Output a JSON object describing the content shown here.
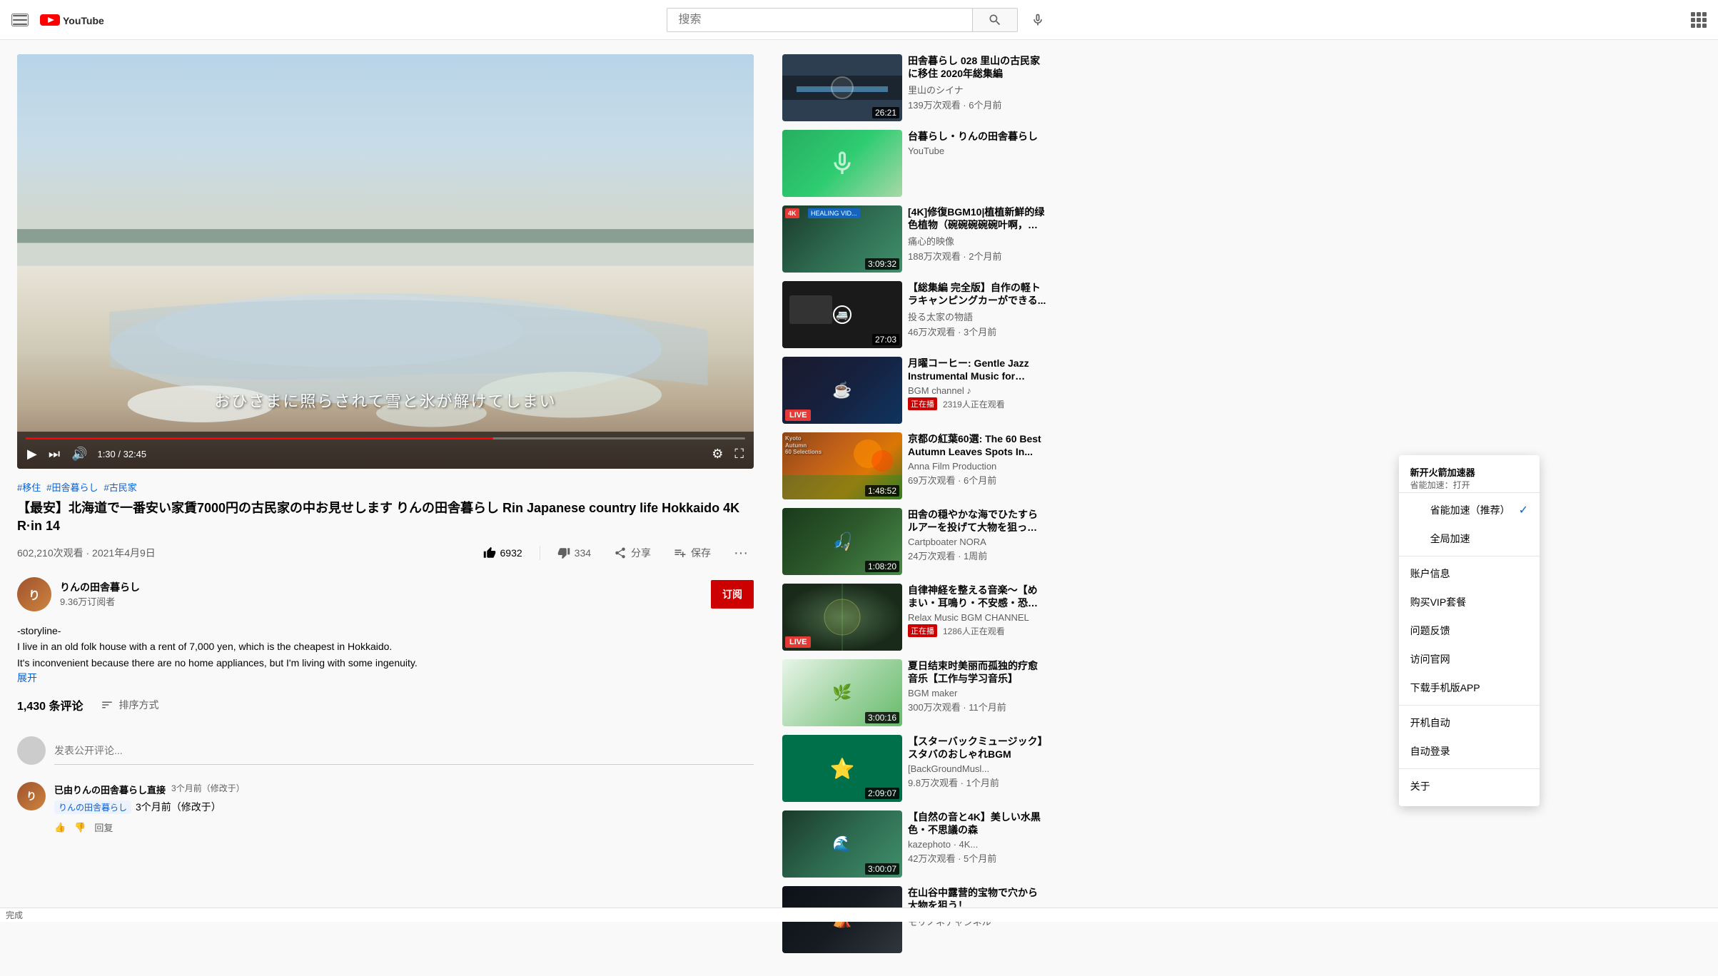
{
  "header": {
    "search_placeholder": "搜索",
    "search_value": ""
  },
  "video": {
    "tags": [
      "#移住",
      "#田舎暮らし",
      "#古民家"
    ],
    "title": "【最安】北海道で一番安い家賃7000円の古民家の中お見せします りんの田舎暮らし Rin Japanese country life Hokkaido 4K R·in 14",
    "views": "602,210次观看 · 2021年4月9日",
    "overlay_text": "おひさまに照らされて雪と氷が解けてしまい",
    "like_count": "6932",
    "dislike_count": "334",
    "share_label": "分享",
    "save_label": "保存",
    "more_label": "···",
    "channel_name": "りんの田舎暮らし",
    "channel_subs": "9.36万订阅者",
    "subscribe_label": "订阅",
    "description_line1": "-storyline-",
    "description_line2": "I live in an old folk house with a rent of 7,000 yen, which is the cheapest in Hokkaido.",
    "description_line3": "It's inconvenient because there are no home appliances, but I'm living with some ingenuity.",
    "expand_label": "展开"
  },
  "comments": {
    "count": "1,430 条评论",
    "sort_label": "排序方式",
    "input_placeholder": "发表公开评论...",
    "items": [
      {
        "author": "已由りんの田舎暮らし直接",
        "time": "3个月前（修改于）",
        "text": "りんの田舎暮らし 3个月前",
        "tag": "りんの田舎暮らし",
        "reply_tag": true
      }
    ]
  },
  "sidebar": {
    "videos": [
      {
        "id": 1,
        "thumb_class": "thumb-bg-1",
        "duration": "26:21",
        "title": "田舎暮らし 028 里山の古民家に移住 2020年総集編",
        "channel": "里山のシイナ",
        "meta": "139万次观看 · 6个月前",
        "live": false
      },
      {
        "id": 2,
        "thumb_class": "thumb-bg-2",
        "duration": "",
        "title": "台暮らし・りんの田舎暮らし",
        "channel": "YouTube",
        "meta": "",
        "live": false,
        "has_mic": true
      },
      {
        "id": 3,
        "thumb_class": "thumb-bg-3",
        "duration": "3:09:32",
        "title": "[4K]修復BGM10|植植新鮮的绿色植物（碗碗碗碗碗叶啊，河水叫...",
        "channel": "痛心的映像",
        "meta": "188万次观看 · 2个月前",
        "live": false
      },
      {
        "id": 4,
        "thumb_class": "thumb-bg-4",
        "duration": "27:03",
        "title": "【総集編 完全版】自作の軽トラキャンピングカーができる...",
        "channel": "投る太家の物語",
        "meta": "46万次观看 · 3个月前",
        "live": false
      },
      {
        "id": 5,
        "thumb_class": "thumb-bg-5",
        "duration": "",
        "title": "月曜コーヒー: Gentle Jazz Instrumental Music for Study...",
        "channel": "BGM channel ♪",
        "meta": "2319人正在观看",
        "live": true,
        "live_label": "正在播"
      },
      {
        "id": 6,
        "thumb_class": "kyoto-thumb",
        "duration": "1:48:52",
        "title": "京都の紅葉60選: The 60 Best Autumn Leaves Spots In...",
        "channel": "Anna Film Production",
        "meta": "69万次观看 · 6个月前",
        "live": false,
        "kyoto": true
      },
      {
        "id": 7,
        "thumb_class": "thumb-bg-7",
        "duration": "1:08:20",
        "title": "田舎の穏やかな海でひたすらルアーを投げて大物を狙ったよ！",
        "channel": "Cartpboater NORA",
        "meta": "24万次观看 · 1周前",
        "live": false
      },
      {
        "id": 8,
        "thumb_class": "thumb-bg-8",
        "duration": "",
        "title": "自律神経を整える音楽〜【めまい・耳鳴り・不安感・恐怖・...",
        "channel": "Relax Music BGM CHANNEL",
        "meta": "1286人正在观看",
        "live": true,
        "live_label": "正在播"
      },
      {
        "id": 9,
        "thumb_class": "thumb-bg-9",
        "duration": "3:00:16",
        "title": "夏日结束时美丽而孤独的疗愈音乐【工作与学习音乐】",
        "channel": "BGM maker",
        "meta": "300万次观看 · 11个月前",
        "live": false
      },
      {
        "id": 10,
        "thumb_class": "starbucks-thumb",
        "duration": "2:09:07",
        "title": "【スターバックミュージック】スタバのおしゃれBGM",
        "channel": "[BackGroundMusl...",
        "meta": "9.8万次观看 · 1个月前",
        "live": false
      },
      {
        "id": 11,
        "thumb_class": "thumb-bg-3",
        "duration": "3:00:07",
        "title": "【自然の音と4K】美しい水黒色・不思議の森",
        "channel": "kazephoto · 4K...",
        "meta": "42万次观看 · 5个月前",
        "live": false
      },
      {
        "id": 12,
        "thumb_class": "thumb-bg-10",
        "duration": "",
        "title": "在山谷中露营的宝物で穴から大物を狙う！",
        "channel": "モリノネチャンネル",
        "meta": "",
        "live": false
      }
    ]
  },
  "context_menu": {
    "header": "省能加速(推荐)",
    "items": [
      {
        "label": "新开火箭加速器",
        "checked": false,
        "sub": "省能加速：打开"
      },
      {
        "label": "省能加速（推荐）",
        "checked": true
      },
      {
        "label": "全局加速",
        "checked": false
      },
      {
        "divider": true
      },
      {
        "label": "账户信息",
        "checked": false
      },
      {
        "label": "购买VIP套餐",
        "checked": false
      },
      {
        "label": "问题反馈",
        "checked": false
      },
      {
        "label": "访问官网",
        "checked": false
      },
      {
        "label": "下载手机版APP",
        "checked": false
      },
      {
        "divider": true
      },
      {
        "label": "开机自动",
        "checked": false
      },
      {
        "label": "自动登录",
        "checked": false
      },
      {
        "divider": true
      },
      {
        "label": "关于",
        "checked": false
      }
    ]
  },
  "footer": {
    "status": "完成"
  }
}
